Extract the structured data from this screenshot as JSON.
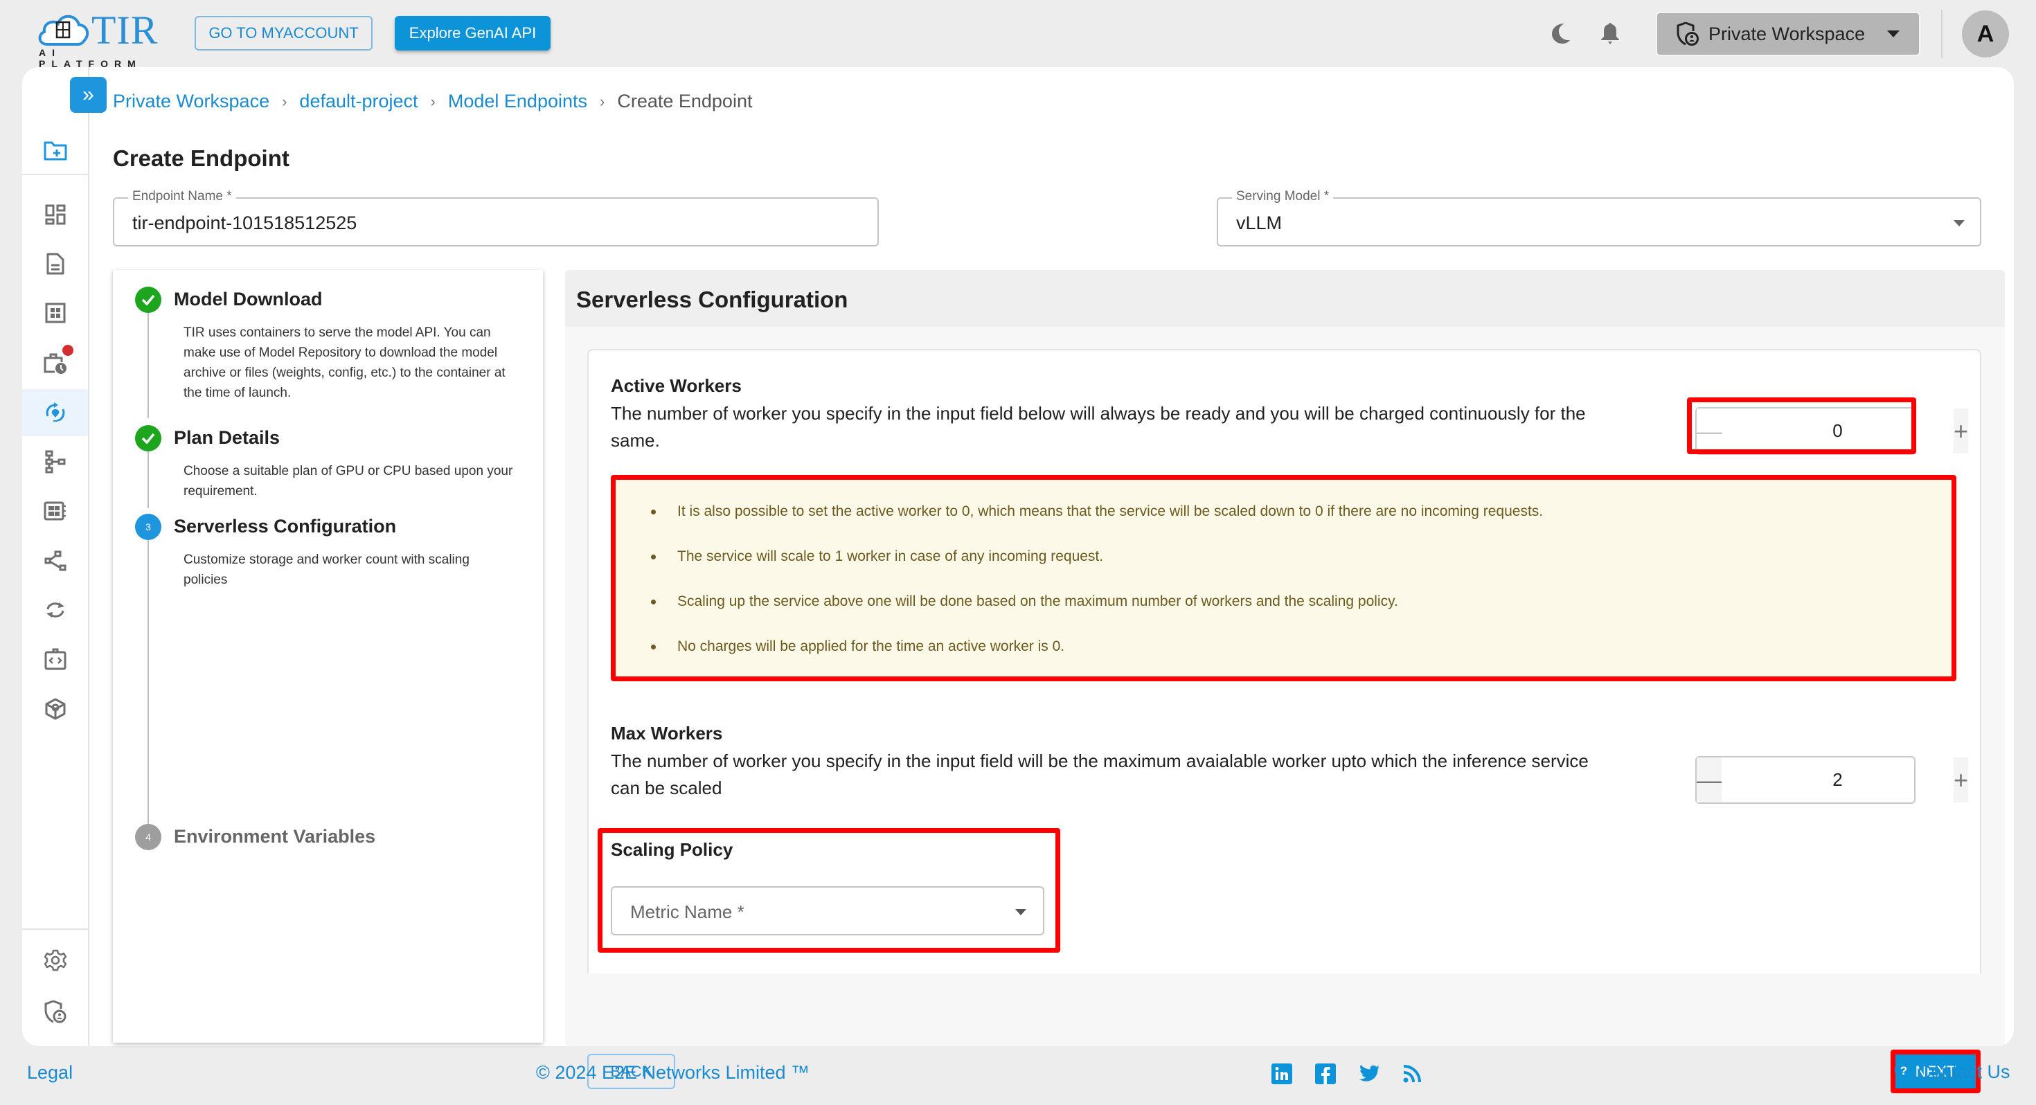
{
  "header": {
    "logo_title": "TIR",
    "logo_subtitle": "AI PLATFORM",
    "myaccount_label": "GO TO MYACCOUNT",
    "explore_label": "Explore GenAI API",
    "workspace_label": "Private Workspace",
    "avatar_initial": "A"
  },
  "sidebar": {
    "items": [
      {
        "icon": "folder-plus-icon",
        "active": false
      },
      {
        "icon": "dashboard-icon",
        "active": false
      },
      {
        "icon": "document-icon",
        "active": false
      },
      {
        "icon": "grid-icon",
        "active": false
      },
      {
        "icon": "scheduled-job-icon",
        "active": false,
        "badge": true
      },
      {
        "icon": "model-endpoint-icon",
        "active": true
      },
      {
        "icon": "pipeline-icon",
        "active": false
      },
      {
        "icon": "registry-icon",
        "active": false
      },
      {
        "icon": "share-nodes-icon",
        "active": false
      },
      {
        "icon": "sync-icon",
        "active": false
      },
      {
        "icon": "api-code-icon",
        "active": false
      },
      {
        "icon": "cube-icon",
        "active": false
      },
      {
        "icon": "settings-icon",
        "active": false
      },
      {
        "icon": "shield-user-icon",
        "active": false
      }
    ]
  },
  "breadcrumb": {
    "items": [
      "Private Workspace",
      "default-project",
      "Model Endpoints"
    ],
    "current": "Create Endpoint",
    "separator": "›"
  },
  "page": {
    "title": "Create Endpoint",
    "endpoint_name_label": "Endpoint Name *",
    "endpoint_name_value": "tir-endpoint-101518512525",
    "serving_model_label": "Serving Model *",
    "serving_model_value": "vLLM"
  },
  "steps": [
    {
      "number": "1",
      "status": "done",
      "title": "Model Download",
      "description": "TIR uses containers to serve the model API. You can make use of Model Repository to download the model archive or files (weights, config, etc.) to the container at the time of launch."
    },
    {
      "number": "2",
      "status": "done",
      "title": "Plan Details",
      "description": "Choose a suitable plan of GPU or CPU based upon your requirement."
    },
    {
      "number": "3",
      "status": "active",
      "title": "Serverless Configuration",
      "description": "Customize storage and worker count with scaling policies"
    },
    {
      "number": "4",
      "status": "pending",
      "title": "Environment Variables",
      "description": ""
    }
  ],
  "config": {
    "title": "Serverless Configuration",
    "active_workers": {
      "title": "Active Workers",
      "description": "The number of worker you specify in the input field below will always be ready and you will be charged continuously for the same.",
      "value": "0"
    },
    "info_points": [
      "It is also possible to set the active worker to 0, which means that the service will be scaled down to 0 if there are no incoming requests.",
      "The service will scale to 1 worker in case of any incoming request.",
      "Scaling up the service above one will be done based on the maximum number of workers and the scaling policy.",
      "No charges will be applied for the time an active worker is 0."
    ],
    "max_workers": {
      "title": "Max Workers",
      "description": "The number of worker you specify in the input field will be the maximum avaialable worker upto which the inference service can be scaled",
      "value": "2"
    },
    "scaling_policy": {
      "title": "Scaling Policy",
      "metric_placeholder": "Metric Name *"
    },
    "back_label": "BACK",
    "next_label": "NEXT"
  },
  "footer": {
    "legal": "Legal",
    "copyright": "© 2024 E2E Networks Limited ™",
    "social": [
      "linkedin-icon",
      "facebook-icon",
      "twitter-icon",
      "rss-icon"
    ],
    "contact": "Contact Us"
  },
  "colors": {
    "brand": "#0d93d8",
    "link": "#1a8ad0",
    "success": "#1ea51e",
    "highlight": "#ff0000",
    "info_bg": "#fdf9e8",
    "info_text": "#6b5a1e"
  }
}
